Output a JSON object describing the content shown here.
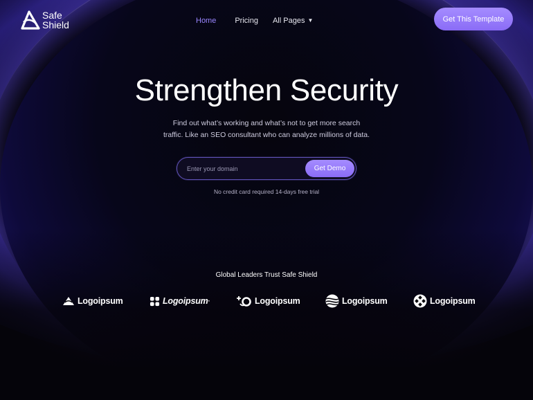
{
  "brand": {
    "name_line1": "Safe",
    "name_line2": "Shield"
  },
  "nav": {
    "items": [
      {
        "label": "Home",
        "active": true
      },
      {
        "label": "Pricing",
        "active": false
      },
      {
        "label": "All Pages",
        "active": false,
        "has_dropdown": true
      }
    ],
    "cta_label": "Get This Template"
  },
  "hero": {
    "title": "Strengthen Security",
    "subtitle": "Find out what’s working and what’s not to get more search traffic. Like an SEO consultant who can analyze millions of data.",
    "input_placeholder": "Enter your domain",
    "input_value": "",
    "submit_label": "Get Demo",
    "note": "No credit card required 14-days free trial"
  },
  "trust": {
    "title": "Global Leaders Trust Safe Shield",
    "logos": [
      {
        "icon": "cloud-triangle-logo-icon",
        "label": "Logoipsum"
      },
      {
        "icon": "flower-logo-icon",
        "label": "Logoipsum",
        "mark": "·"
      },
      {
        "icon": "spark-ring-logo-icon",
        "label": "Logoipsum"
      },
      {
        "icon": "wave-globe-logo-icon",
        "label": "Logoipsum"
      },
      {
        "icon": "diamond-circle-logo-icon",
        "label": "Logoipsum"
      }
    ]
  },
  "colors": {
    "background": "#05040a",
    "accent": "#9a86ff",
    "button_gradient_top": "#a58cff",
    "button_gradient_bottom": "#8a6cf6",
    "glow": "#4b3ad0"
  }
}
